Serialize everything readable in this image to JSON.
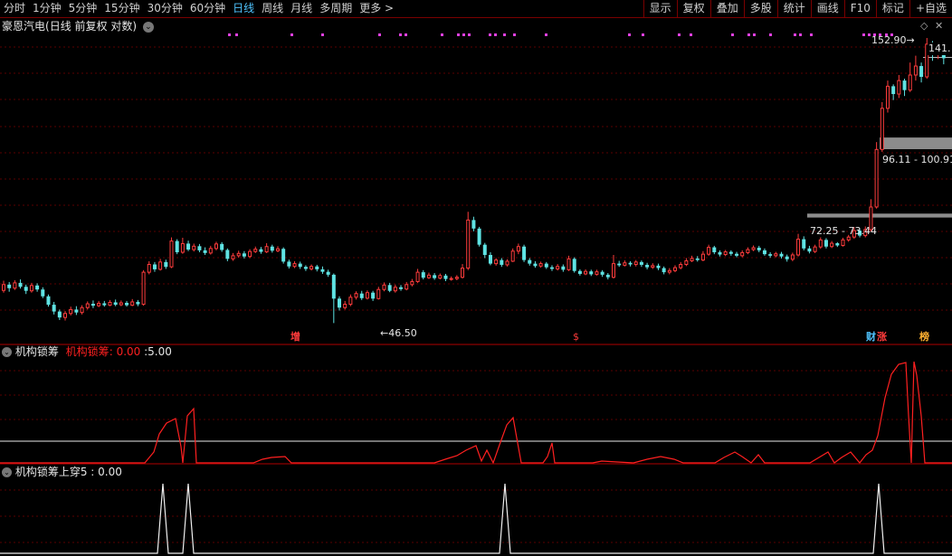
{
  "toolbar": {
    "periods": [
      "分时",
      "1分钟",
      "5分钟",
      "15分钟",
      "30分钟",
      "60分钟",
      "日线",
      "周线",
      "月线",
      "多周期",
      "更多 >"
    ],
    "active_period": "日线",
    "tools": [
      "显示",
      "复权",
      "叠加",
      "多股",
      "统计",
      "画线",
      "F10",
      "标记",
      "+自选"
    ]
  },
  "main_chart": {
    "stock_name": "豪恩汽电",
    "settings": "(日线 前复权 对数)",
    "high_label": "152.90",
    "low_label": "46.50",
    "right_price": "141.",
    "zone_high_label": "96.11 - 100.91",
    "zone_low_label": "72.25 - 73.44",
    "events": [
      {
        "text": "增",
        "color": "#ff3b3b"
      },
      {
        "text": "$",
        "color": "#ff3b3b"
      },
      {
        "text": "财",
        "color": "#4fc4ff"
      },
      {
        "text": "涨",
        "color": "#ff3b3b"
      },
      {
        "text": "榜",
        "color": "#ffb030"
      }
    ],
    "colors": {
      "up": "#ff3c3c",
      "down": "#5fe3e3",
      "magenta": "#e040e0",
      "zone": "#8c8c8c"
    }
  },
  "panel1": {
    "title": "机构锁筹",
    "legend_name": "机构锁筹",
    "legend_value": "0.00",
    "threshold_value": "5.00",
    "colors": {
      "line": "#ff2020",
      "threshold": "#e8e8e8"
    }
  },
  "panel2": {
    "title": "机构锁筹上穿5",
    "value": "0.00"
  },
  "chart_data": {
    "type": "candlestick",
    "price_min": 44,
    "price_max": 160,
    "log_scale": true,
    "candles": [
      [
        53.3,
        54.6,
        55.5,
        52.8
      ],
      [
        54.6,
        53.8,
        55.2,
        53.0
      ],
      [
        53.8,
        55.0,
        55.6,
        53.4
      ],
      [
        55.0,
        54.1,
        55.8,
        53.7
      ],
      [
        54.1,
        53.2,
        54.6,
        52.5
      ],
      [
        53.2,
        54.4,
        55.0,
        52.8
      ],
      [
        54.4,
        53.5,
        54.9,
        53.0
      ],
      [
        53.5,
        52.0,
        54.0,
        51.6
      ],
      [
        52.0,
        50.2,
        52.4,
        49.8
      ],
      [
        50.2,
        48.8,
        50.8,
        48.2
      ],
      [
        48.8,
        47.6,
        49.2,
        47.1
      ],
      [
        47.6,
        48.4,
        48.9,
        47.0
      ],
      [
        48.4,
        49.2,
        49.8,
        48.0
      ],
      [
        49.2,
        48.6,
        49.9,
        48.1
      ],
      [
        48.6,
        49.6,
        50.1,
        48.2
      ],
      [
        49.6,
        50.4,
        50.9,
        49.2
      ],
      [
        50.4,
        50.0,
        51.1,
        49.5
      ],
      [
        50.0,
        50.5,
        51.0,
        49.7
      ],
      [
        50.5,
        50.1,
        51.0,
        49.8
      ],
      [
        50.1,
        50.7,
        51.2,
        49.9
      ],
      [
        50.7,
        50.2,
        51.3,
        49.9
      ],
      [
        50.2,
        50.6,
        51.1,
        49.9
      ],
      [
        50.6,
        50.1,
        51.0,
        49.8
      ],
      [
        50.1,
        50.8,
        51.4,
        49.9
      ],
      [
        50.8,
        50.3,
        51.2,
        49.9
      ],
      [
        50.3,
        57.5,
        58.0,
        50.0
      ],
      [
        57.5,
        59.4,
        60.2,
        57.0
      ],
      [
        59.4,
        58.2,
        60.0,
        57.6
      ],
      [
        58.2,
        60.0,
        60.8,
        57.9
      ],
      [
        60.0,
        58.8,
        60.6,
        58.3
      ],
      [
        58.8,
        65.5,
        66.5,
        58.5
      ],
      [
        65.5,
        62.5,
        66.0,
        62.0
      ],
      [
        62.5,
        64.8,
        66.4,
        62.1
      ],
      [
        64.8,
        63.2,
        65.6,
        62.8
      ],
      [
        63.2,
        64.1,
        64.8,
        62.7
      ],
      [
        64.1,
        63.0,
        64.7,
        62.5
      ],
      [
        63.0,
        62.3,
        63.8,
        61.8
      ],
      [
        62.3,
        63.5,
        64.2,
        61.9
      ],
      [
        63.5,
        64.7,
        65.3,
        63.0
      ],
      [
        64.7,
        63.1,
        65.2,
        62.6
      ],
      [
        63.1,
        60.8,
        63.5,
        60.2
      ],
      [
        60.8,
        61.6,
        62.3,
        60.3
      ],
      [
        61.6,
        62.2,
        62.9,
        61.1
      ],
      [
        62.2,
        61.4,
        62.8,
        60.9
      ],
      [
        61.4,
        62.7,
        63.3,
        61.0
      ],
      [
        62.7,
        63.3,
        64.0,
        62.3
      ],
      [
        63.3,
        62.6,
        63.9,
        62.1
      ],
      [
        62.6,
        64.0,
        64.9,
        62.3
      ],
      [
        64.0,
        62.9,
        64.5,
        62.4
      ],
      [
        62.9,
        63.4,
        64.1,
        62.5
      ],
      [
        63.4,
        60.1,
        63.8,
        59.6
      ],
      [
        60.1,
        58.9,
        60.6,
        58.4
      ],
      [
        58.9,
        59.6,
        60.2,
        58.5
      ],
      [
        59.6,
        58.8,
        60.1,
        58.3
      ],
      [
        58.8,
        58.3,
        59.2,
        57.8
      ],
      [
        58.3,
        58.9,
        59.4,
        57.9
      ],
      [
        58.9,
        58.2,
        59.3,
        57.7
      ],
      [
        58.2,
        57.6,
        58.9,
        57.1
      ],
      [
        57.6,
        56.9,
        58.1,
        56.4
      ],
      [
        56.9,
        51.5,
        57.2,
        46.5
      ],
      [
        51.5,
        49.6,
        52.0,
        49.0
      ],
      [
        49.6,
        50.3,
        51.0,
        49.2
      ],
      [
        50.3,
        51.8,
        52.4,
        49.9
      ],
      [
        51.8,
        52.6,
        53.1,
        51.3
      ],
      [
        52.6,
        51.6,
        53.2,
        51.2
      ],
      [
        51.6,
        52.8,
        53.3,
        51.3
      ],
      [
        52.8,
        51.5,
        53.2,
        51.0
      ],
      [
        51.5,
        53.5,
        54.1,
        51.3
      ],
      [
        53.5,
        54.5,
        55.1,
        53.1
      ],
      [
        54.5,
        53.2,
        55.0,
        52.9
      ],
      [
        53.2,
        54.0,
        54.6,
        52.8
      ],
      [
        54.0,
        53.6,
        54.5,
        53.2
      ],
      [
        53.6,
        54.6,
        55.2,
        53.3
      ],
      [
        54.6,
        55.3,
        55.9,
        54.2
      ],
      [
        55.3,
        57.5,
        58.3,
        55.0
      ],
      [
        57.5,
        56.2,
        58.0,
        55.8
      ],
      [
        56.2,
        56.8,
        57.4,
        55.9
      ],
      [
        56.8,
        56.1,
        57.3,
        55.7
      ],
      [
        56.1,
        56.7,
        57.2,
        55.8
      ],
      [
        56.7,
        55.9,
        57.1,
        55.4
      ],
      [
        55.9,
        56.0,
        56.5,
        55.5
      ],
      [
        56.0,
        56.3,
        56.8,
        55.6
      ],
      [
        56.3,
        58.5,
        59.5,
        56.0
      ],
      [
        58.5,
        71.5,
        74.0,
        58.0
      ],
      [
        71.5,
        69.0,
        72.5,
        68.2
      ],
      [
        69.0,
        64.5,
        69.5,
        64.0
      ],
      [
        64.5,
        61.8,
        65.0,
        61.0
      ],
      [
        61.8,
        59.6,
        62.5,
        59.2
      ],
      [
        59.6,
        60.5,
        61.0,
        59.1
      ],
      [
        60.5,
        59.3,
        61.0,
        58.8
      ],
      [
        59.3,
        60.2,
        60.7,
        58.9
      ],
      [
        60.2,
        62.8,
        63.5,
        60.0
      ],
      [
        62.8,
        64.0,
        64.8,
        62.0
      ],
      [
        64.0,
        60.5,
        64.5,
        60.0
      ],
      [
        60.5,
        59.6,
        61.0,
        59.1
      ],
      [
        59.6,
        59.0,
        60.2,
        58.6
      ],
      [
        59.0,
        59.6,
        60.1,
        58.6
      ],
      [
        59.6,
        58.7,
        60.0,
        58.3
      ],
      [
        58.7,
        58.3,
        59.2,
        57.8
      ],
      [
        58.3,
        58.9,
        59.5,
        57.9
      ],
      [
        58.9,
        58.1,
        59.4,
        57.6
      ],
      [
        58.1,
        60.8,
        61.6,
        57.8
      ],
      [
        60.8,
        57.8,
        61.2,
        57.4
      ],
      [
        57.8,
        57.1,
        58.2,
        56.7
      ],
      [
        57.1,
        57.7,
        58.2,
        56.8
      ],
      [
        57.7,
        57.0,
        58.1,
        56.6
      ],
      [
        57.0,
        57.6,
        58.1,
        56.7
      ],
      [
        57.6,
        56.9,
        58.0,
        56.4
      ],
      [
        56.9,
        56.3,
        57.3,
        55.8
      ],
      [
        56.3,
        59.6,
        61.8,
        56.0
      ],
      [
        59.6,
        59.2,
        60.3,
        58.8
      ],
      [
        59.2,
        59.8,
        60.4,
        58.9
      ],
      [
        59.8,
        59.4,
        60.2,
        58.9
      ],
      [
        59.4,
        60.0,
        60.5,
        58.9
      ],
      [
        60.0,
        59.3,
        60.4,
        58.8
      ],
      [
        59.3,
        58.7,
        59.8,
        58.2
      ],
      [
        58.7,
        59.1,
        59.7,
        58.3
      ],
      [
        59.1,
        58.5,
        59.6,
        58.0
      ],
      [
        58.5,
        57.5,
        58.9,
        57.0
      ],
      [
        57.5,
        57.9,
        58.5,
        57.0
      ],
      [
        57.9,
        58.6,
        59.2,
        57.5
      ],
      [
        58.6,
        59.4,
        60.0,
        58.2
      ],
      [
        59.4,
        60.3,
        61.0,
        59.0
      ],
      [
        60.3,
        60.9,
        61.6,
        60.0
      ],
      [
        60.9,
        60.5,
        61.5,
        60.1
      ],
      [
        60.5,
        62.0,
        62.8,
        60.2
      ],
      [
        62.0,
        63.8,
        64.5,
        61.6
      ],
      [
        63.8,
        62.5,
        64.2,
        62.0
      ],
      [
        62.5,
        61.9,
        63.0,
        61.4
      ],
      [
        61.9,
        62.6,
        63.1,
        61.5
      ],
      [
        62.6,
        62.1,
        63.0,
        61.6
      ],
      [
        62.1,
        61.6,
        62.6,
        61.2
      ],
      [
        61.6,
        62.4,
        63.0,
        61.2
      ],
      [
        62.4,
        63.2,
        63.8,
        62.0
      ],
      [
        63.2,
        63.7,
        64.3,
        62.8
      ],
      [
        63.7,
        63.0,
        64.2,
        62.5
      ],
      [
        63.0,
        62.0,
        63.5,
        61.6
      ],
      [
        62.0,
        61.6,
        62.5,
        61.1
      ],
      [
        61.6,
        62.1,
        62.6,
        61.2
      ],
      [
        62.1,
        61.4,
        62.6,
        60.9
      ],
      [
        61.4,
        60.7,
        61.9,
        60.1
      ],
      [
        60.7,
        61.8,
        62.4,
        60.2
      ],
      [
        61.8,
        66.0,
        67.5,
        61.4
      ],
      [
        66.0,
        63.5,
        66.8,
        63.0
      ],
      [
        63.5,
        62.7,
        64.2,
        62.2
      ],
      [
        62.7,
        63.9,
        64.5,
        62.3
      ],
      [
        63.9,
        65.8,
        66.5,
        63.4
      ],
      [
        65.8,
        64.0,
        66.3,
        63.5
      ],
      [
        64.0,
        64.9,
        65.5,
        63.6
      ],
      [
        64.9,
        64.3,
        65.2,
        63.9
      ],
      [
        64.3,
        65.8,
        66.4,
        64.0
      ],
      [
        65.8,
        66.6,
        67.2,
        65.3
      ],
      [
        66.6,
        68.4,
        69.4,
        66.1
      ],
      [
        68.4,
        67.0,
        68.9,
        66.5
      ],
      [
        67.0,
        68.7,
        69.6,
        66.5
      ],
      [
        68.7,
        75.5,
        78.0,
        68.2
      ],
      [
        75.5,
        96.0,
        99.0,
        75.0
      ],
      [
        96.0,
        114.0,
        117.0,
        95.0
      ],
      [
        114.0,
        125.0,
        128.0,
        112.0
      ],
      [
        125.0,
        121.0,
        126.0,
        118.0
      ],
      [
        121.0,
        128.0,
        131.0,
        119.0
      ],
      [
        128.0,
        123.0,
        129.0,
        120.0
      ],
      [
        123.0,
        131.0,
        138.0,
        122.0
      ],
      [
        131.0,
        136.0,
        142.0,
        128.0
      ],
      [
        136.0,
        130.0,
        138.0,
        127.0
      ],
      [
        130.0,
        149.0,
        152.9,
        129.0
      ],
      [
        149.0,
        144.0,
        151.0,
        139.0
      ],
      [
        144.0,
        147.0,
        150.0,
        140.0
      ],
      [
        147.0,
        140.5,
        148.0,
        137.0
      ]
    ]
  }
}
